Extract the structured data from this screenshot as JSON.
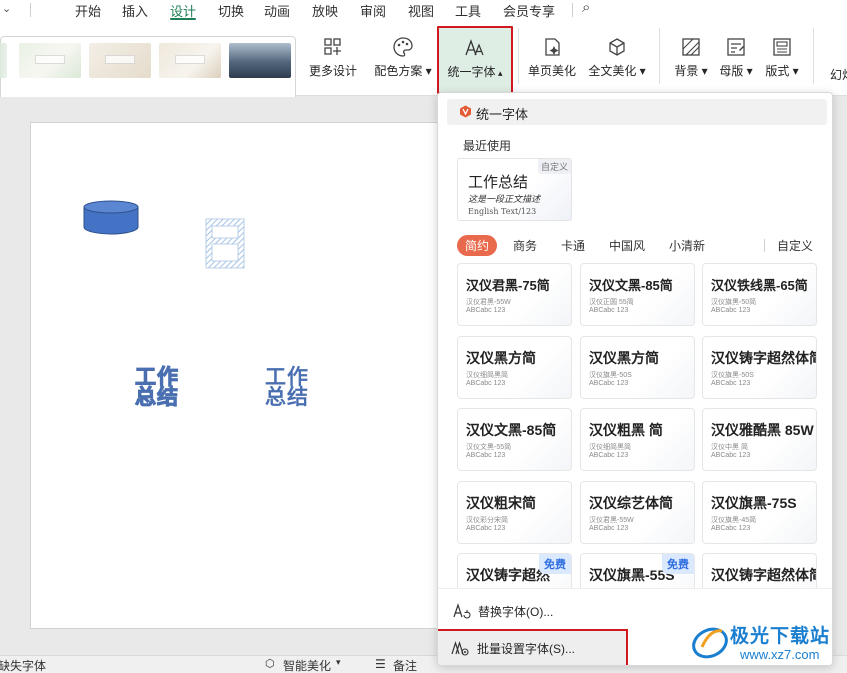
{
  "menu": {
    "tabs": [
      "开始",
      "插入",
      "设计",
      "切换",
      "动画",
      "放映",
      "审阅",
      "视图",
      "工具",
      "会员专享"
    ],
    "active": "设计"
  },
  "ribbon": {
    "more_design": "更多设计",
    "color_scheme": "配色方案",
    "unify_font": "统一字体",
    "page_beautify": "单页美化",
    "full_beautify": "全文美化",
    "background": "背景",
    "master": "母版",
    "layout": "版式",
    "slide_truncated": "幻灯"
  },
  "slide": {
    "text_outline": "工作\n总结",
    "text_solid": "工作\n总结"
  },
  "panel": {
    "title": "统一字体",
    "recent_title": "最近使用",
    "recent_card": {
      "tag": "自定义",
      "line1": "工作总结",
      "line2": "这是一段正文描述",
      "line3": "English Text/123"
    },
    "categories": [
      "简约",
      "商务",
      "卡通",
      "中国风",
      "小清新"
    ],
    "active_category": "简约",
    "custom": "自定义",
    "fonts": [
      {
        "name": "汉仪君黑-75简",
        "sub": "汉仪君黑-55W",
        "sample": "ABCabc 123"
      },
      {
        "name": "汉仪文黑-85简",
        "sub": "汉仪正圆 55简",
        "sample": "ABCabc 123"
      },
      {
        "name": "汉仪铁线黑-65简",
        "sub": "汉仪旗黑-50简",
        "sample": "ABCabc 123"
      },
      {
        "name": "汉仪黑方简",
        "sub": "汉仪细简黑简",
        "sample": "ABCabc 123"
      },
      {
        "name": "汉仪黑方简",
        "sub": "汉仪旗黑-50S",
        "sample": "ABCabc 123"
      },
      {
        "name": "汉仪铸字超然体简",
        "sub": "汉仪旗黑-50S",
        "sample": "ABCabc 123"
      },
      {
        "name": "汉仪文黑-85简",
        "sub": "汉仪文黑-55简",
        "sample": "ABCabc 123"
      },
      {
        "name": "汉仪粗黑 简",
        "sub": "汉仪细简黑简",
        "sample": "ABCabc 123"
      },
      {
        "name": "汉仪雅酷黑 85W",
        "sub": "汉仪中黑 简",
        "sample": "ABCabc 123"
      },
      {
        "name": "汉仪粗宋简",
        "sub": "汉仪彩分宋简",
        "sample": "ABCabc 123"
      },
      {
        "name": "汉仪综艺体简",
        "sub": "汉仪君黑-55W",
        "sample": "ABCabc 123"
      },
      {
        "name": "汉仪旗黑-75S",
        "sub": "汉仪旗黑-45简",
        "sample": "ABCabc 123"
      },
      {
        "name": "汉仪铸字超然",
        "sub": "汉仪润黑简-55",
        "sample": "ABCabc 123",
        "badge": "免费"
      },
      {
        "name": "汉仪旗黑-55S",
        "sub": "汉仪旗黑-55简",
        "sample": "ABCabc 123",
        "badge": "免费"
      },
      {
        "name": "汉仪铸字超然体简",
        "sub": "汉仪旗黑-50S",
        "sample": "ABCabc 123"
      }
    ],
    "replace_font": "替换字体(O)...",
    "batch_font": "批量设置字体(S)..."
  },
  "statusbar": {
    "missing_font": "缺失字体",
    "smart_beautify": "智能美化",
    "notes": "备注"
  },
  "watermark": {
    "title": "极光下载站",
    "url": "www.xz7.com"
  },
  "colors": {
    "accent_green": "#1e7e55",
    "highlight_red": "#d0181e",
    "category_active": "#e9694c",
    "free_badge_text": "#2f6fe0",
    "watermark_blue": "#1b7fd0",
    "shape_blue": "#4472c4"
  }
}
